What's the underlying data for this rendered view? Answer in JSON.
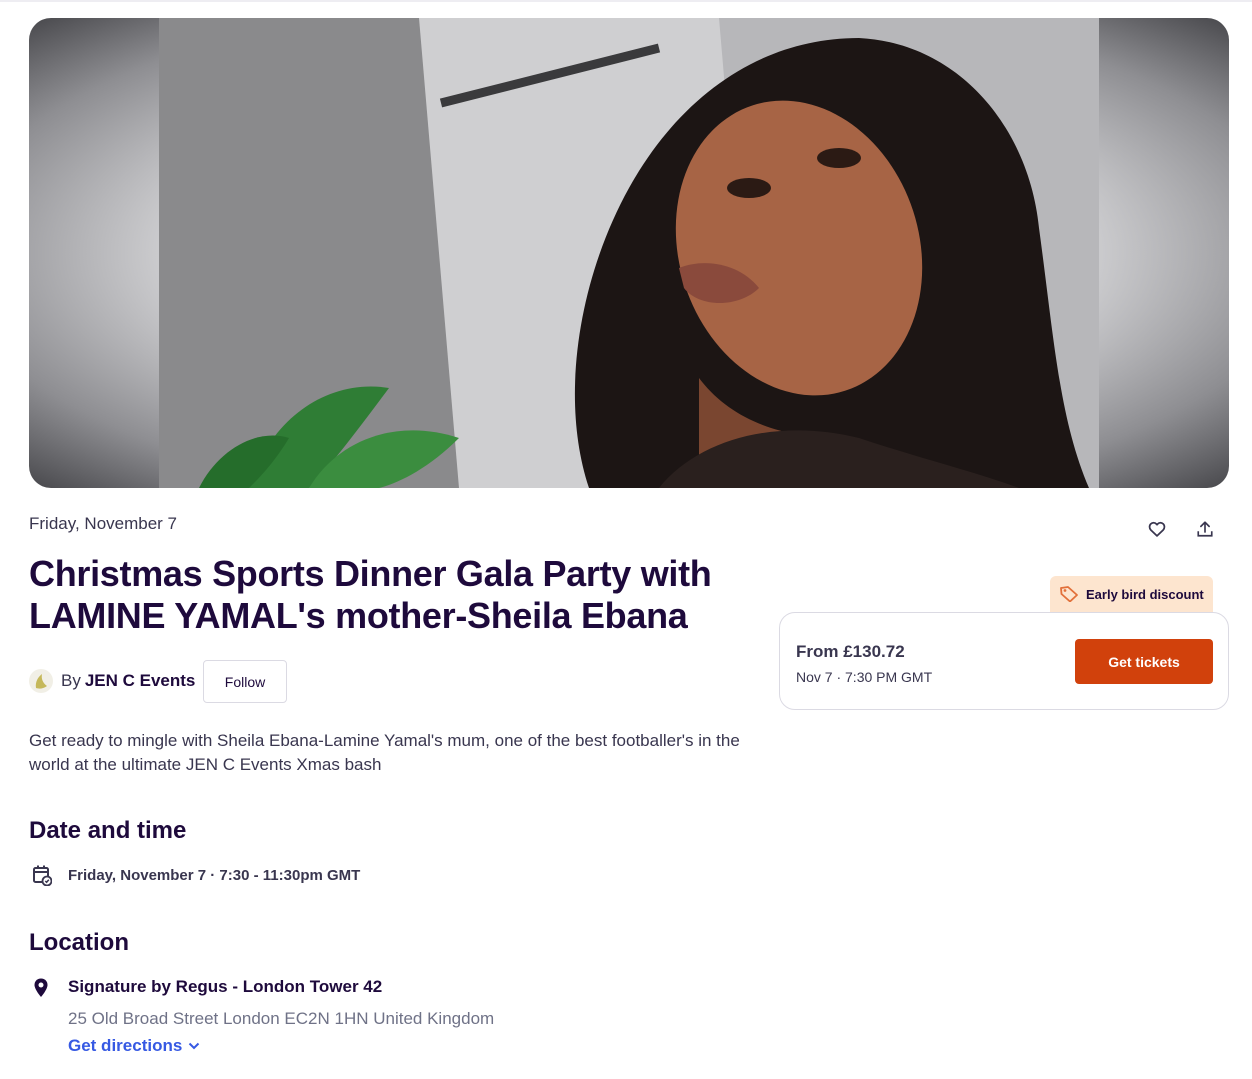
{
  "event": {
    "date_short": "Friday, November 7",
    "title": "Christmas Sports Dinner Gala Party with LAMINE YAMAL's mother-Sheila Ebana",
    "summary": "Get ready to mingle with Sheila Ebana-Lamine Yamal's mum, one of the best footballer's in the world at the ultimate JEN C Events Xmas bash"
  },
  "organizer": {
    "by_label": "By",
    "name": "JEN C Events",
    "follow_label": "Follow"
  },
  "actions": {
    "like_icon": "heart-icon",
    "share_icon": "share-icon"
  },
  "date_time": {
    "heading": "Date and time",
    "value": "Friday, November 7 · 7:30 - 11:30pm GMT"
  },
  "location": {
    "heading": "Location",
    "venue": "Signature by Regus - London Tower 42",
    "address": "25 Old Broad Street London EC2N 1HN United Kingdom",
    "directions_label": "Get directions"
  },
  "ticket": {
    "badge": "Early bird discount",
    "price": "From £130.72",
    "date": "Nov 7 · 7:30 PM GMT",
    "cta": "Get tickets"
  },
  "colors": {
    "brand_orange": "#d1410c",
    "link_blue": "#3659e3",
    "title_purple": "#1e0a3c",
    "badge_bg": "#fde5cf"
  }
}
